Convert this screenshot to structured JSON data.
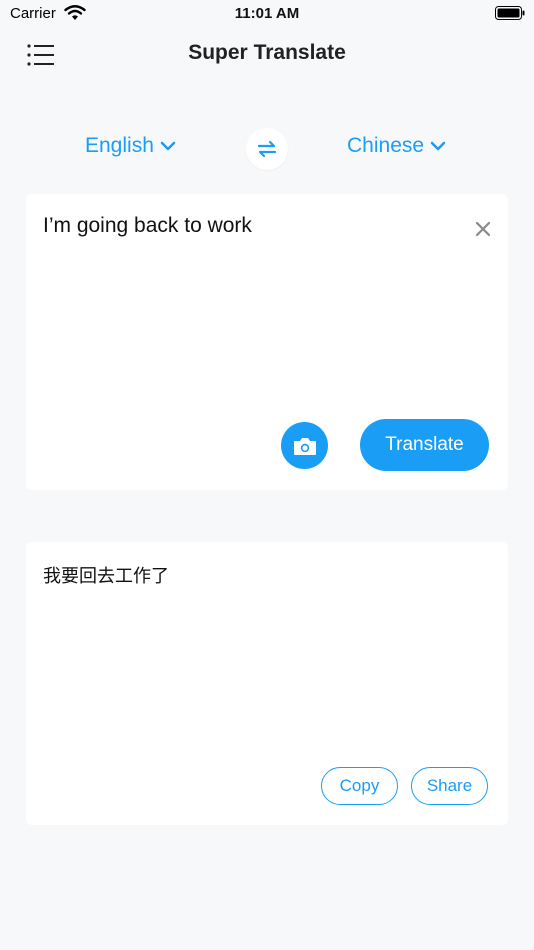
{
  "status_bar": {
    "carrier": "Carrier",
    "time": "11:01 AM"
  },
  "header": {
    "title": "Super Translate",
    "menu_icon": "hamburger-menu-icon"
  },
  "languages": {
    "source": "English",
    "target": "Chinese",
    "swap_icon": "swap-arrows-icon"
  },
  "input": {
    "text": "I’m going back to work",
    "clear_icon": "close-icon",
    "camera_icon": "camera-icon",
    "translate_label": "Translate"
  },
  "output": {
    "text": "我要回去工作了",
    "copy_label": "Copy",
    "share_label": "Share"
  },
  "colors": {
    "accent": "#1a9ef5",
    "background": "#f7f8fa",
    "card": "#ffffff"
  }
}
